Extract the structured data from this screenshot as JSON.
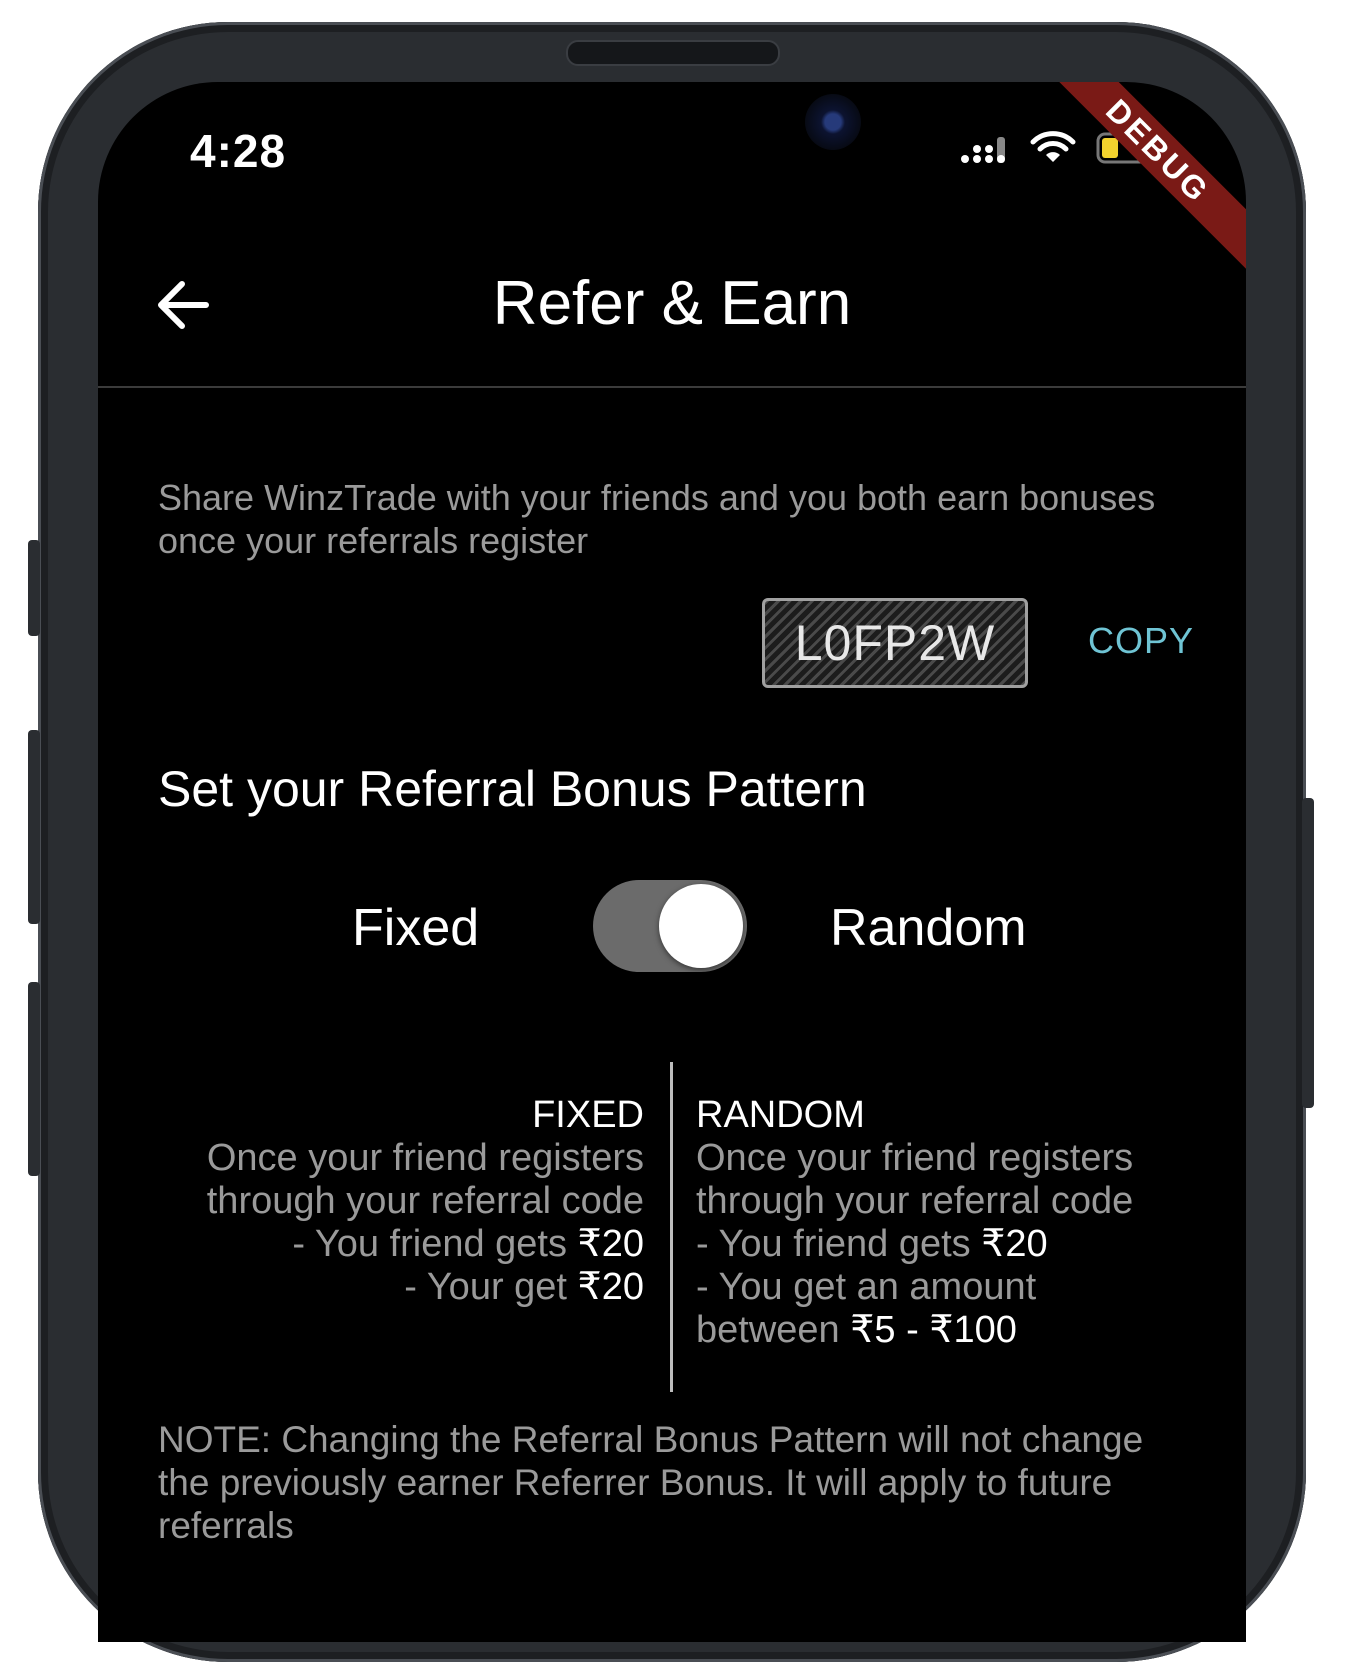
{
  "status_bar": {
    "time": "4:28",
    "debug_label": "DEBUG"
  },
  "app_bar": {
    "title": "Refer & Earn"
  },
  "intro_text": "Share WinzTrade with your friends and you both earn bonuses once your referrals register",
  "referral": {
    "code": "L0FP2W",
    "copy_label": "COPY"
  },
  "pattern": {
    "title": "Set your Referral Bonus Pattern",
    "left_label": "Fixed",
    "right_label": "Random",
    "selected": "Random"
  },
  "fixed": {
    "heading": "FIXED",
    "line1": "Once your friend registers",
    "line2": "through your referral code",
    "line3_prefix": "- You friend gets ",
    "line3_amount": "₹20",
    "line4_prefix": "- Your get ",
    "line4_amount": "₹20"
  },
  "random": {
    "heading": "RANDOM",
    "line1": "Once your friend registers",
    "line2": "through your referral code",
    "line3_prefix": "- You friend gets ",
    "line3_amount": "₹20",
    "line4": "- You get an amount",
    "line5_prefix": "between ",
    "line5_amount": "₹5 - ₹100"
  },
  "note": "NOTE: Changing the Referral Bonus Pattern will not change the previously earner Referrer Bonus. It will apply to future referrals",
  "colors": {
    "accent": "#6fc4d4",
    "background": "#000000",
    "debug_ribbon": "#7a1a16"
  }
}
